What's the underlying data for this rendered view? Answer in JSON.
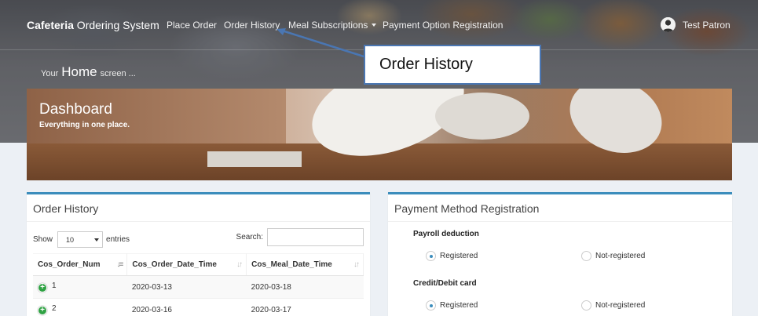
{
  "navbar": {
    "brand_bold": "Cafeteria",
    "brand_rest": " Ordering System",
    "links": {
      "place_order": "Place Order",
      "order_history": "Order History",
      "meal_subscriptions": "Meal Subscriptions",
      "payment_option": "Payment Option Registration"
    },
    "user_name": "Test Patron"
  },
  "callout": {
    "text": "Order History"
  },
  "home_line": {
    "prefix": "Your",
    "big": "Home",
    "suffix": "screen ..."
  },
  "banner": {
    "title": "Dashboard",
    "subtitle": "Everything in one place."
  },
  "order_history": {
    "title": "Order History",
    "show_label": "Show",
    "entries_value": "10",
    "entries_label": "entries",
    "search_label": "Search:",
    "columns": [
      "Cos_Order_Num",
      "Cos_Order_Date_Time",
      "Cos_Meal_Date_Time"
    ],
    "rows": [
      [
        "1",
        "2020-03-13",
        "2020-03-18"
      ],
      [
        "2",
        "2020-03-16",
        "2020-03-17"
      ]
    ]
  },
  "payment": {
    "title": "Payment Method Registration",
    "groups": [
      {
        "label": "Payroll deduction",
        "option_a": "Registered",
        "option_b": "Not-registered",
        "selected": "Registered"
      },
      {
        "label": "Credit/Debit card",
        "option_a": "Registered",
        "option_b": "Not-registered",
        "selected": "Registered"
      }
    ]
  },
  "colors": {
    "accent": "#3c8dbc",
    "callout_border": "#4a76b2",
    "plus_icon": "#2fa243"
  }
}
